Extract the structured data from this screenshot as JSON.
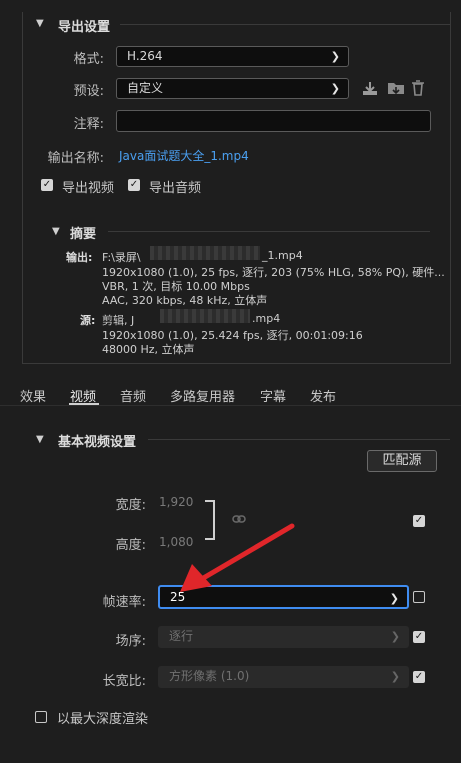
{
  "export_settings": {
    "title": "导出设置",
    "format_label": "格式:",
    "format_value": "H.264",
    "preset_label": "预设:",
    "preset_value": "自定义",
    "comment_label": "注释:",
    "comment_value": "",
    "output_name_label": "输出名称:",
    "output_name_value": "Java面试题大全_1.mp4",
    "export_video_label": "导出视频",
    "export_audio_label": "导出音频",
    "export_video_checked": true,
    "export_audio_checked": true
  },
  "summary": {
    "title": "摘要",
    "output_label": "输出:",
    "output_lines": [
      "F:\\录屏\\",
      "_1.mp4",
      "1920x1080 (1.0), 25 fps, 逐行, 203 (75% HLG, 58% PQ), 硬件...",
      "VBR, 1 次, 目标 10.00 Mbps",
      "AAC, 320 kbps, 48 kHz, 立体声"
    ],
    "source_label": "源:",
    "source_lines": [
      "剪辑, J",
      ".mp4",
      "1920x1080 (1.0), 25.424 fps, 逐行, 00:01:09:16",
      "48000 Hz, 立体声"
    ]
  },
  "tabs": [
    "效果",
    "视频",
    "音频",
    "多路复用器",
    "字幕",
    "发布"
  ],
  "active_tab": "视频",
  "basic_video": {
    "title": "基本视频设置",
    "match_source_label": "匹配源",
    "width_label": "宽度:",
    "width_value": "1,920",
    "height_label": "高度:",
    "height_value": "1,080",
    "frame_rate_label": "帧速率:",
    "frame_rate_value": "25",
    "field_order_label": "场序:",
    "field_order_value": "逐行",
    "aspect_label": "长宽比:",
    "aspect_value": "方形像素 (1.0)",
    "max_depth_label": "以最大深度渲染"
  },
  "colors": {
    "accent": "#3f8cf0",
    "link": "#4a9ff0",
    "arrow": "#e0262a",
    "background": "#1e1e1e"
  },
  "icons": {
    "save_preset": "download-icon",
    "import_preset": "folder-import-icon",
    "delete_preset": "trash-icon",
    "link": "chain-link-icon"
  }
}
